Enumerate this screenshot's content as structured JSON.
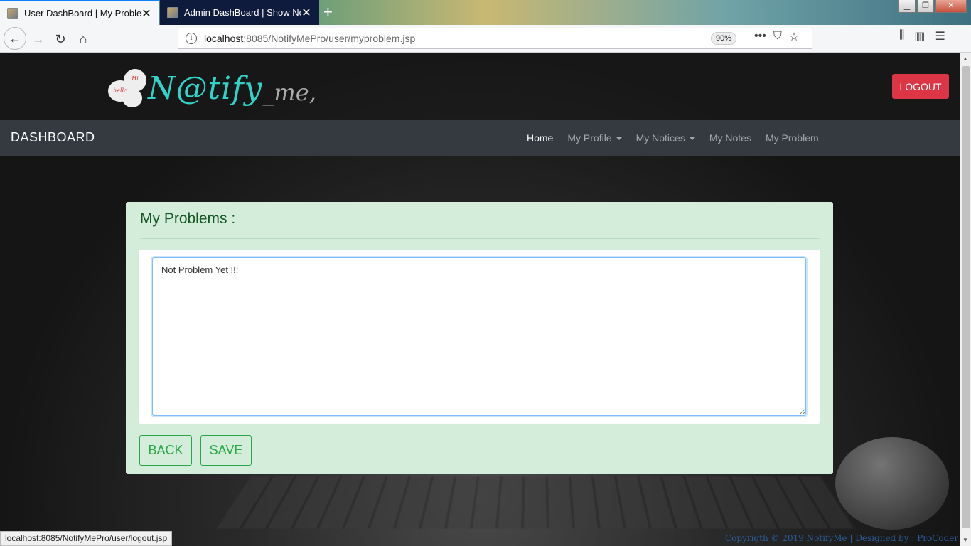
{
  "browser": {
    "tabs": [
      {
        "title": "User DashBoard | My Problem",
        "active": true
      },
      {
        "title": "Admin DashBoard | Show Notic",
        "active": false
      }
    ],
    "new_tab": "+",
    "url_host": "localhost",
    "url_path": ":8085/NotifyMePro/user/myproblem.jsp",
    "zoom": "90%",
    "status_url": "localhost:8085/NotifyMePro/user/logout.jsp"
  },
  "header": {
    "logo_text": "N@tify",
    "logo_sub": "_me,",
    "logo_bubbles": [
      "hello",
      "Hi"
    ],
    "logout_label": "LOGOUT"
  },
  "menubar": {
    "brand": "DASHBOARD",
    "items": [
      {
        "label": "Home",
        "dropdown": false
      },
      {
        "label": "My Profile",
        "dropdown": true
      },
      {
        "label": "My Notices",
        "dropdown": true
      },
      {
        "label": "My Notes",
        "dropdown": false
      },
      {
        "label": "My Problem",
        "dropdown": false
      }
    ]
  },
  "card": {
    "title": "My Problems :",
    "textarea_value": "Not Problem Yet !!!",
    "back_label": "BACK",
    "save_label": "SAVE"
  },
  "footer": {
    "text": "Copyrigth © 2019 NotifyMe | Designed by : ProCoder"
  },
  "colors": {
    "logout": "#dc3545",
    "menubar": "#343a40",
    "card_bg": "#d4eddb",
    "success": "#28a745",
    "logo": "#2fd3c8"
  }
}
